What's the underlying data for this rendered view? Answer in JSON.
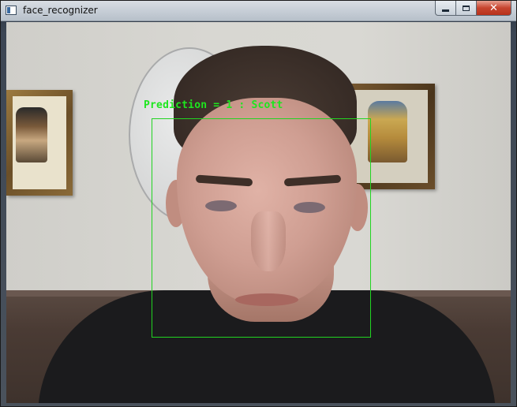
{
  "window": {
    "title": "face_recognizer",
    "app_icon": "opencv-window-icon",
    "controls": {
      "minimize_icon": "minimize-icon",
      "maximize_icon": "maximize-icon",
      "close_icon": "close-icon",
      "close_glyph": "✕"
    }
  },
  "frame": {
    "description_free": true,
    "overlay": {
      "prediction_text": "Prediction = 1 : Scott",
      "color": "#22d422"
    }
  }
}
